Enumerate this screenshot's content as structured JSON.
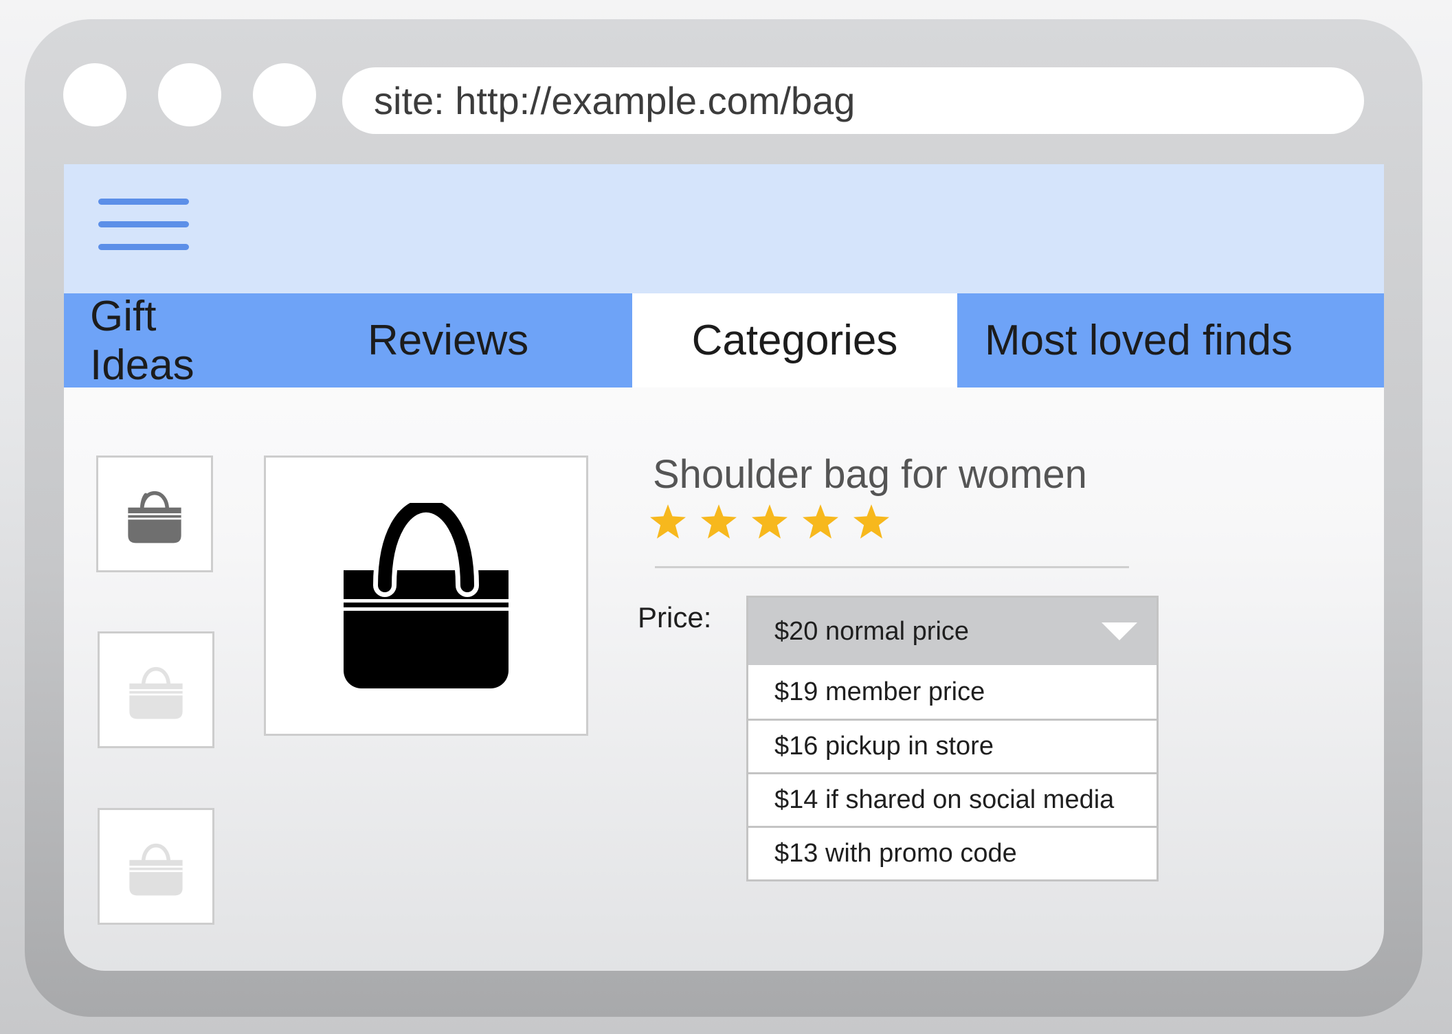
{
  "browser": {
    "url": "site: http://example.com/bag"
  },
  "nav": {
    "tabs": [
      {
        "label": "Gift Ideas"
      },
      {
        "label": "Reviews"
      },
      {
        "label": "Categories"
      },
      {
        "label": "Most loved finds"
      }
    ],
    "active_tab": "Categories"
  },
  "product": {
    "title": "Shoulder bag for women",
    "rating": 5,
    "rating_max": 5,
    "price_label": "Price:",
    "price_selected": "$20 normal price",
    "price_options": [
      "$19 member price",
      "$16 pickup in store",
      "$14 if shared on social media",
      "$13 with promo code"
    ]
  },
  "colors": {
    "header_bg": "#d5e4fb",
    "tab_bg": "#6ea3f7",
    "tab_active_bg": "#ffffff",
    "star": "#f7b81d",
    "hamburger": "#5c8fe8"
  },
  "icons": [
    "menu-icon",
    "bag-icon",
    "star-icon",
    "chevron-down-icon"
  ]
}
